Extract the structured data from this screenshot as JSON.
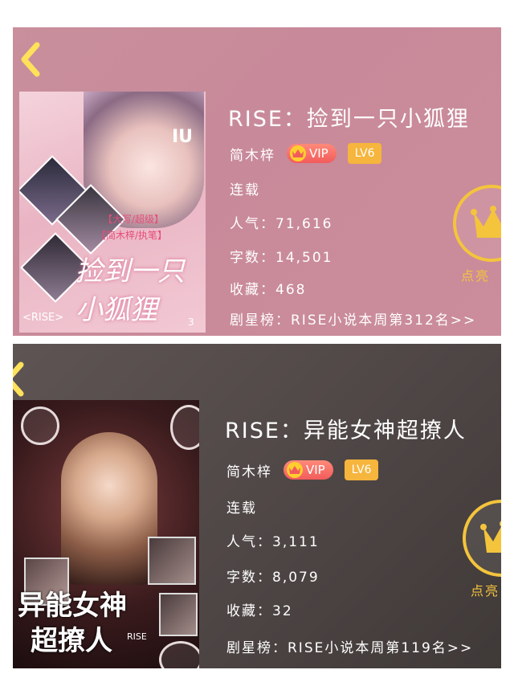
{
  "books": [
    {
      "title": "RISE：捡到一只小狐狸",
      "author": "简木梓",
      "vip_label": "VIP",
      "level": "LV6",
      "status": "连载",
      "popularity_label": "人气：71,616",
      "word_count_label": "字数：14,501",
      "collections_label": "收藏：468",
      "ranking_label": "剧星榜：RISE小说本周第312名>>",
      "light_up_label": "点亮",
      "cover": {
        "line1": "捡到一只",
        "line2": "小狐狸",
        "tag1": "【大写/超级】",
        "tag2": "【简木梓/执笔】",
        "corner": "IU",
        "bottom": "<RISE>",
        "number": "3"
      }
    },
    {
      "title": "RISE：异能女神超撩人",
      "author": "简木梓",
      "vip_label": "VIP",
      "level": "LV6",
      "status": "连载",
      "popularity_label": "人气：3,111",
      "word_count_label": "字数：8,079",
      "collections_label": "收藏：32",
      "ranking_label": "剧星榜：RISE小说本周第119名>>",
      "light_up_label": "点亮",
      "cover": {
        "line1": "异能女神",
        "line2": "超撩人",
        "tag": "RISE"
      }
    }
  ],
  "colors": {
    "card1_bg": "#c98f9c",
    "card2_bg": "#4d4544",
    "accent_gold": "#f4c43c",
    "vip_red": "#f25b5b",
    "level_orange": "#f6b53c"
  },
  "icons": [
    "back-arrow-icon",
    "crown-icon",
    "vip-crown-icon"
  ]
}
